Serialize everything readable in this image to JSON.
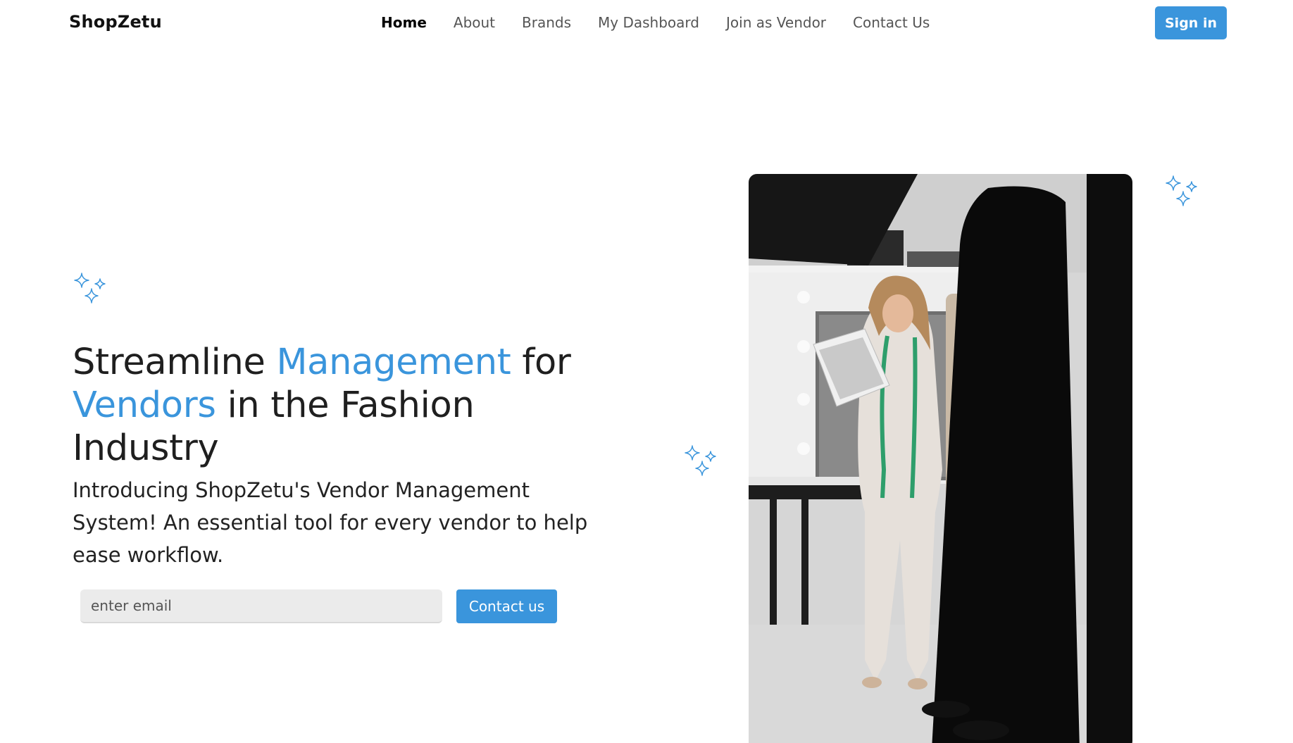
{
  "nav": {
    "brand": "ShopZetu",
    "links": [
      {
        "label": "Home",
        "active": true
      },
      {
        "label": "About",
        "active": false
      },
      {
        "label": "Brands",
        "active": false
      },
      {
        "label": "My Dashboard",
        "active": false
      },
      {
        "label": "Join as Vendor",
        "active": false
      },
      {
        "label": "Contact Us",
        "active": false
      }
    ],
    "signin_label": "Sign in"
  },
  "hero": {
    "title_part1": "Streamline ",
    "title_accent1": "Management",
    "title_part2": " for ",
    "title_accent2": "Vendors",
    "title_part3": " in the Fashion Industry",
    "subtitle": "Introducing ShopZetu's Vendor Management System! An essential tool for every vendor to help ease workflow.",
    "email_placeholder": "enter email",
    "contact_label": "Contact us"
  },
  "colors": {
    "accent": "#3a95dc",
    "text": "#1f1f1f",
    "input_bg": "#ebebeb"
  },
  "icons": [
    "sparkle-icon",
    "sparkle-icon",
    "sparkle-icon"
  ]
}
